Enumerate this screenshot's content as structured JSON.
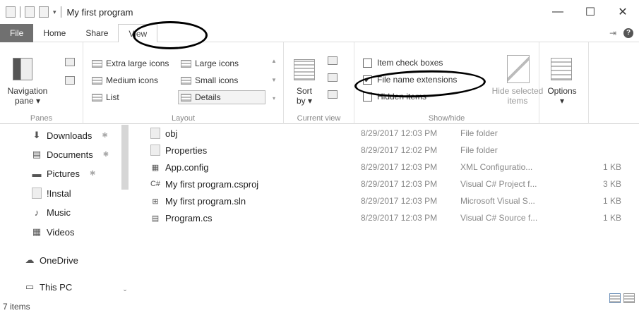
{
  "window": {
    "title": "My first program",
    "minimize": "—",
    "maximize": "☐",
    "close": "✕"
  },
  "qat": {
    "dropdown": "▾"
  },
  "tabs": [
    {
      "label": "File"
    },
    {
      "label": "Home"
    },
    {
      "label": "Share"
    },
    {
      "label": "View"
    }
  ],
  "ribbon": {
    "panes": {
      "navigation_pane_line1": "Navigation",
      "navigation_pane_line2": "pane ▾",
      "label": "Panes"
    },
    "layout": {
      "items": [
        {
          "label": "Extra large icons"
        },
        {
          "label": "Large icons"
        },
        {
          "label": "Medium icons"
        },
        {
          "label": "Small icons"
        },
        {
          "label": "List"
        },
        {
          "label": "Details"
        }
      ],
      "label": "Layout"
    },
    "current_view": {
      "sort_line1": "Sort",
      "sort_line2": "by ▾",
      "label": "Current view"
    },
    "show_hide": {
      "item_check_boxes": {
        "label": "Item check boxes",
        "checked": false
      },
      "file_name_extensions": {
        "label": "File name extensions",
        "checked": true
      },
      "hidden_items": {
        "label": "Hidden items",
        "checked": false
      },
      "hide_selected_line1": "Hide selected",
      "hide_selected_line2": "items",
      "label": "Show/hide"
    },
    "options": {
      "label": "Options",
      "arrow": "▾"
    }
  },
  "sidebar": {
    "items": [
      {
        "label": "Downloads",
        "icon": "download-icon",
        "pinned": true
      },
      {
        "label": "Documents",
        "icon": "document-icon",
        "pinned": true
      },
      {
        "label": "Pictures",
        "icon": "pictures-icon",
        "pinned": true
      },
      {
        "label": "!Instal",
        "icon": "folder-icon",
        "pinned": false
      },
      {
        "label": "Music",
        "icon": "music-icon",
        "pinned": false
      },
      {
        "label": "Videos",
        "icon": "videos-icon",
        "pinned": false
      },
      {
        "label": "OneDrive",
        "icon": "cloud-icon",
        "pinned": false
      },
      {
        "label": "This PC",
        "icon": "computer-icon",
        "pinned": false
      }
    ]
  },
  "files": [
    {
      "name": "obj",
      "date": "8/29/2017 12:03 PM",
      "type": "File folder",
      "size": ""
    },
    {
      "name": "Properties",
      "date": "8/29/2017 12:02 PM",
      "type": "File folder",
      "size": ""
    },
    {
      "name": "App.config",
      "date": "8/29/2017 12:03 PM",
      "type": "XML Configuratio...",
      "size": "1 KB"
    },
    {
      "name": "My first program.csproj",
      "date": "8/29/2017 12:03 PM",
      "type": "Visual C# Project f...",
      "size": "3 KB"
    },
    {
      "name": "My first program.sln",
      "date": "8/29/2017 12:03 PM",
      "type": "Microsoft Visual S...",
      "size": "1 KB"
    },
    {
      "name": "Program.cs",
      "date": "8/29/2017 12:03 PM",
      "type": "Visual C# Source f...",
      "size": "1 KB"
    }
  ],
  "status": {
    "items_count": "7 items"
  }
}
